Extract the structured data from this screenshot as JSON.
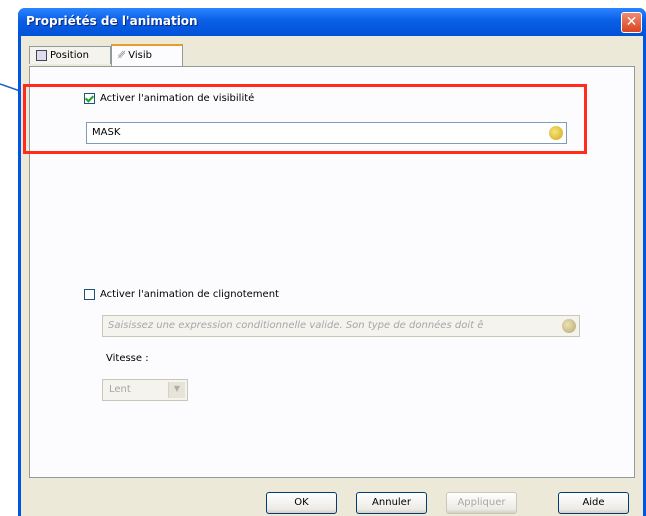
{
  "window": {
    "title": "Propriétés de l'animation",
    "close_glyph": "✕"
  },
  "tabs": [
    {
      "label": "Position",
      "icon": "position-icon"
    },
    {
      "label": "Visib",
      "icon": "visibility-icon"
    }
  ],
  "visibility": {
    "enable_label": "Activer l'animation de visibilité",
    "enabled": true,
    "expression_value": "MASK"
  },
  "blink": {
    "enable_label": "Activer l'animation de clignotement",
    "enabled": false,
    "expression_placeholder": "Saisissez une expression conditionnelle valide. Son type de données doit ê",
    "speed_label": "Vitesse :",
    "speed_value": "Lent"
  },
  "buttons": {
    "ok": "OK",
    "cancel": "Annuler",
    "apply": "Appliquer",
    "help": "Aide"
  },
  "colors": {
    "titlebar": "#0a5fe6",
    "highlight": "#ff2b1b",
    "annotation_arrow": "#1c5fc9"
  }
}
